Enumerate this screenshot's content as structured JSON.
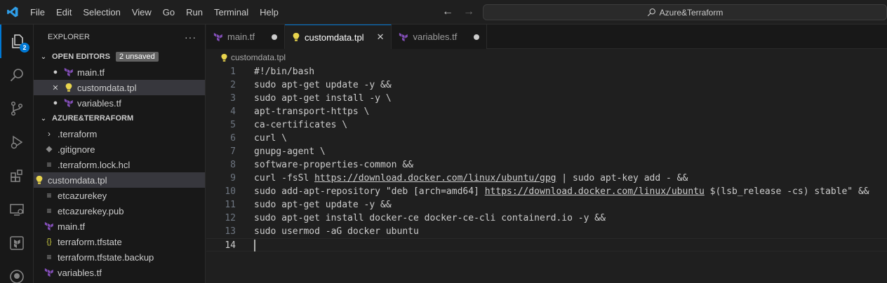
{
  "titlebar": {
    "menu": [
      "File",
      "Edit",
      "Selection",
      "View",
      "Go",
      "Run",
      "Terminal",
      "Help"
    ],
    "search": "Azure&Terraform"
  },
  "activitybar": {
    "explorer_badge": "2",
    "accent": "#0078d4"
  },
  "sidebar": {
    "title": "EXPLORER",
    "more": "···",
    "open_editors": {
      "label": "OPEN EDITORS",
      "badge": "2 unsaved",
      "items": [
        {
          "name": "main.tf",
          "state": "dot",
          "icon": "terraform-icon"
        },
        {
          "name": "customdata.tpl",
          "state": "close",
          "icon": "lightbulb-icon"
        },
        {
          "name": "variables.tf",
          "state": "dot",
          "icon": "terraform-icon"
        }
      ]
    },
    "folder": {
      "label": "AZURE&TERRAFORM",
      "items": [
        {
          "name": ".terraform",
          "icon": "chevron-right-icon"
        },
        {
          "name": ".gitignore",
          "icon": "git-icon"
        },
        {
          "name": ".terraform.lock.hcl",
          "icon": "lines-icon"
        },
        {
          "name": "customdata.tpl",
          "icon": "lightbulb-icon"
        },
        {
          "name": "etcazurekey",
          "icon": "lines-icon"
        },
        {
          "name": "etcazurekey.pub",
          "icon": "lines-icon"
        },
        {
          "name": "main.tf",
          "icon": "terraform-icon"
        },
        {
          "name": "terraform.tfstate",
          "icon": "json-icon"
        },
        {
          "name": "terraform.tfstate.backup",
          "icon": "lines-icon"
        },
        {
          "name": "variables.tf",
          "icon": "terraform-icon"
        }
      ]
    }
  },
  "tabs": [
    {
      "label": "main.tf",
      "icon": "terraform-icon",
      "state": "dot"
    },
    {
      "label": "customdata.tpl",
      "icon": "lightbulb-icon",
      "state": "close"
    },
    {
      "label": "variables.tf",
      "icon": "terraform-icon",
      "state": "dot"
    }
  ],
  "breadcrumb": "customdata.tpl",
  "editor": {
    "lines": [
      {
        "num": "1",
        "code": "#!/bin/bash"
      },
      {
        "num": "2",
        "code": "sudo apt-get update -y &&"
      },
      {
        "num": "3",
        "code": "sudo apt-get install -y \\"
      },
      {
        "num": "4",
        "code": "apt-transport-https \\"
      },
      {
        "num": "5",
        "code": "ca-certificates \\"
      },
      {
        "num": "6",
        "code": "curl \\"
      },
      {
        "num": "7",
        "code": "gnupg-agent \\"
      },
      {
        "num": "8",
        "code": "software-properties-common &&"
      },
      {
        "num": "9",
        "pre": "curl -fsSl ",
        "link": "https://download.docker.com/linux/ubuntu/gpg",
        "post": " | sudo apt-key add - &&"
      },
      {
        "num": "10",
        "pre": "sudo add-apt-repository \"deb [arch=amd64] ",
        "link": "https://download.docker.com/linux/ubuntu",
        "post": " $(lsb_release -cs) stable\" &&"
      },
      {
        "num": "11",
        "code": "sudo apt-get update -y &&"
      },
      {
        "num": "12",
        "code": "sudo apt-get install docker-ce docker-ce-cli containerd.io -y &&"
      },
      {
        "num": "13",
        "code": "sudo usermod -aG docker ubuntu"
      },
      {
        "num": "14",
        "code": ""
      }
    ]
  }
}
